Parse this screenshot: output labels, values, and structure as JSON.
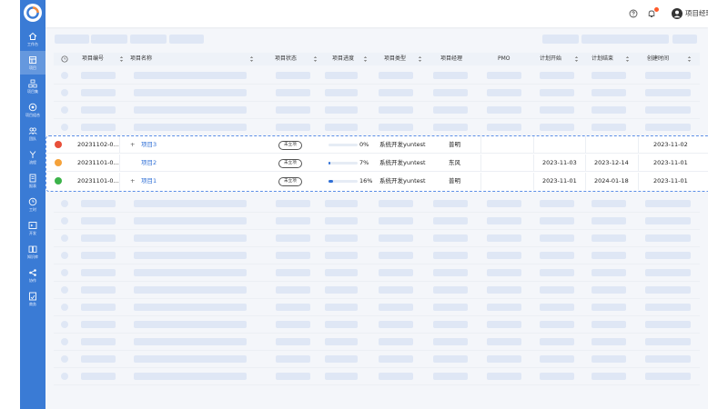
{
  "topbar": {
    "user_name": "项目经理 PM"
  },
  "sidebar": {
    "items": [
      {
        "label": "工作台",
        "icon": "home-icon"
      },
      {
        "label": "项目",
        "icon": "project-icon",
        "active": true
      },
      {
        "label": "项目集",
        "icon": "program-icon"
      },
      {
        "label": "项目组合",
        "icon": "portfolio-icon"
      },
      {
        "label": "团队",
        "icon": "team-icon"
      },
      {
        "label": "流程",
        "icon": "flow-icon"
      },
      {
        "label": "报表",
        "icon": "report-icon"
      },
      {
        "label": "工时",
        "icon": "timesheet-icon"
      },
      {
        "label": "开发",
        "icon": "dev-icon"
      },
      {
        "label": "知识库",
        "icon": "wiki-icon"
      },
      {
        "label": "协作",
        "icon": "collab-icon"
      },
      {
        "label": "商务",
        "icon": "business-icon"
      }
    ]
  },
  "table": {
    "columns": [
      "项目编号",
      "项目名称",
      "项目状态",
      "项目进度",
      "项目类型",
      "项目经理",
      "PMO",
      "计划开始",
      "计划结束",
      "创建时间"
    ],
    "rows": [
      {
        "status_color": "#e8503a",
        "code": "20231102-0...",
        "expand": "+",
        "name": "项目3",
        "state": "未立项",
        "progress": "0%",
        "progress_value": 0,
        "type": "系统开发yuntest",
        "manager": "普明",
        "pmo": "",
        "plan_start": "",
        "plan_end": "",
        "created": "2023-11-02"
      },
      {
        "status_color": "#f5a23a",
        "code": "20231101-0...",
        "expand": "",
        "name": "项目2",
        "state": "未立项",
        "progress": "7%",
        "progress_value": 7,
        "type": "系统开发yuntest",
        "manager": "东风",
        "pmo": "",
        "plan_start": "2023-11-03",
        "plan_end": "2023-12-14",
        "created": "2023-11-01"
      },
      {
        "status_color": "#3cb34a",
        "code": "20231101-0...",
        "expand": "+",
        "name": "项目1",
        "state": "未立项",
        "progress": "16%",
        "progress_value": 16,
        "type": "系统开发yuntest",
        "manager": "普明",
        "pmo": "",
        "plan_start": "2023-11-01",
        "plan_end": "2024-01-18",
        "created": "2023-11-01"
      }
    ]
  },
  "colors": {
    "brand": "#3a7bd5",
    "link": "#2f6fd6",
    "skeleton": "#dfe7f5"
  }
}
